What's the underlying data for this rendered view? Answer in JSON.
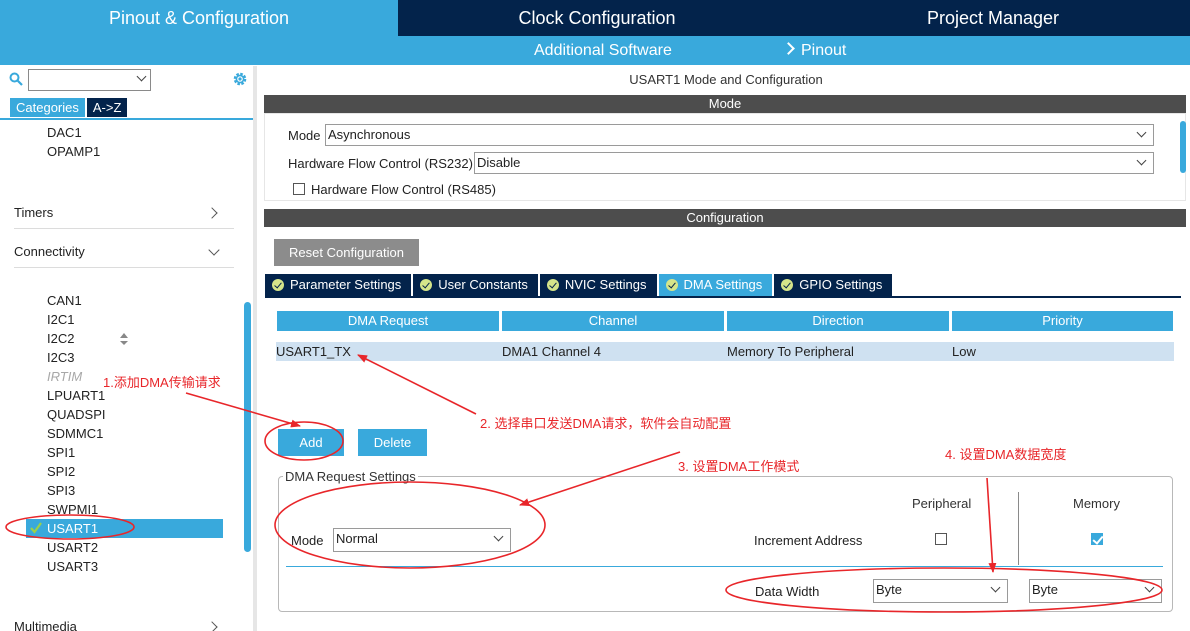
{
  "top_tabs": [
    "Pinout & Configuration",
    "Clock Configuration",
    "Project Manager"
  ],
  "sub_nav": {
    "additional_software": "Additional Software",
    "pinout": "Pinout"
  },
  "left": {
    "search": {
      "value": ""
    },
    "view_tabs": [
      "Categories",
      "A->Z"
    ],
    "analog_items": [
      "DAC1",
      "OPAMP1"
    ],
    "categories": {
      "timers": "Timers",
      "connectivity": "Connectivity"
    },
    "connectivity_items": [
      "CAN1",
      "I2C1",
      "I2C2",
      "I2C3",
      "IRTIM",
      "LPUART1",
      "QUADSPI",
      "SDMMC1",
      "SPI1",
      "SPI2",
      "SPI3",
      "SWPMI1",
      "USART1",
      "USART2",
      "USART3"
    ],
    "disabled_item": "IRTIM",
    "selected_item": "USART1",
    "partial_category": "Multimedia"
  },
  "right": {
    "title": "USART1 Mode and Configuration",
    "mode_header": "Mode",
    "mode": {
      "mode_label": "Mode",
      "mode_value": "Asynchronous",
      "hwfc_label": "Hardware Flow Control (RS232)",
      "hwfc_value": "Disable",
      "rs485_label": "Hardware Flow Control (RS485)",
      "rs485_checked": false
    },
    "config_header": "Configuration",
    "reset_button": "Reset Configuration",
    "config_tabs": [
      "Parameter Settings",
      "User Constants",
      "NVIC Settings",
      "DMA Settings",
      "GPIO Settings"
    ],
    "active_tab": "DMA Settings",
    "dma_table": {
      "columns": [
        "DMA Request",
        "Channel",
        "Direction",
        "Priority"
      ],
      "rows": [
        [
          "USART1_TX",
          "DMA1 Channel 4",
          "Memory To Peripheral",
          "Low"
        ]
      ]
    },
    "add_button": "Add",
    "delete_button": "Delete",
    "request_settings": {
      "legend": "DMA Request Settings",
      "mode_label": "Mode",
      "mode_value": "Normal",
      "peripheral_header": "Peripheral",
      "memory_header": "Memory",
      "increment_label": "Increment Address",
      "peripheral_increment": false,
      "memory_increment": true,
      "data_width_label": "Data Width",
      "peripheral_width": "Byte",
      "memory_width": "Byte"
    }
  },
  "annotations": {
    "a1": "1.添加DMA传输请求",
    "a2": "2. 选择串口发送DMA请求，软件会自动配置",
    "a3": "3. 设置DMA工作模式",
    "a4": "4. 设置DMA数据宽度",
    "color": "#e8262a"
  },
  "colors": {
    "accent": "#39a9dc",
    "dark": "#03234b",
    "section": "#4d4d4d"
  }
}
